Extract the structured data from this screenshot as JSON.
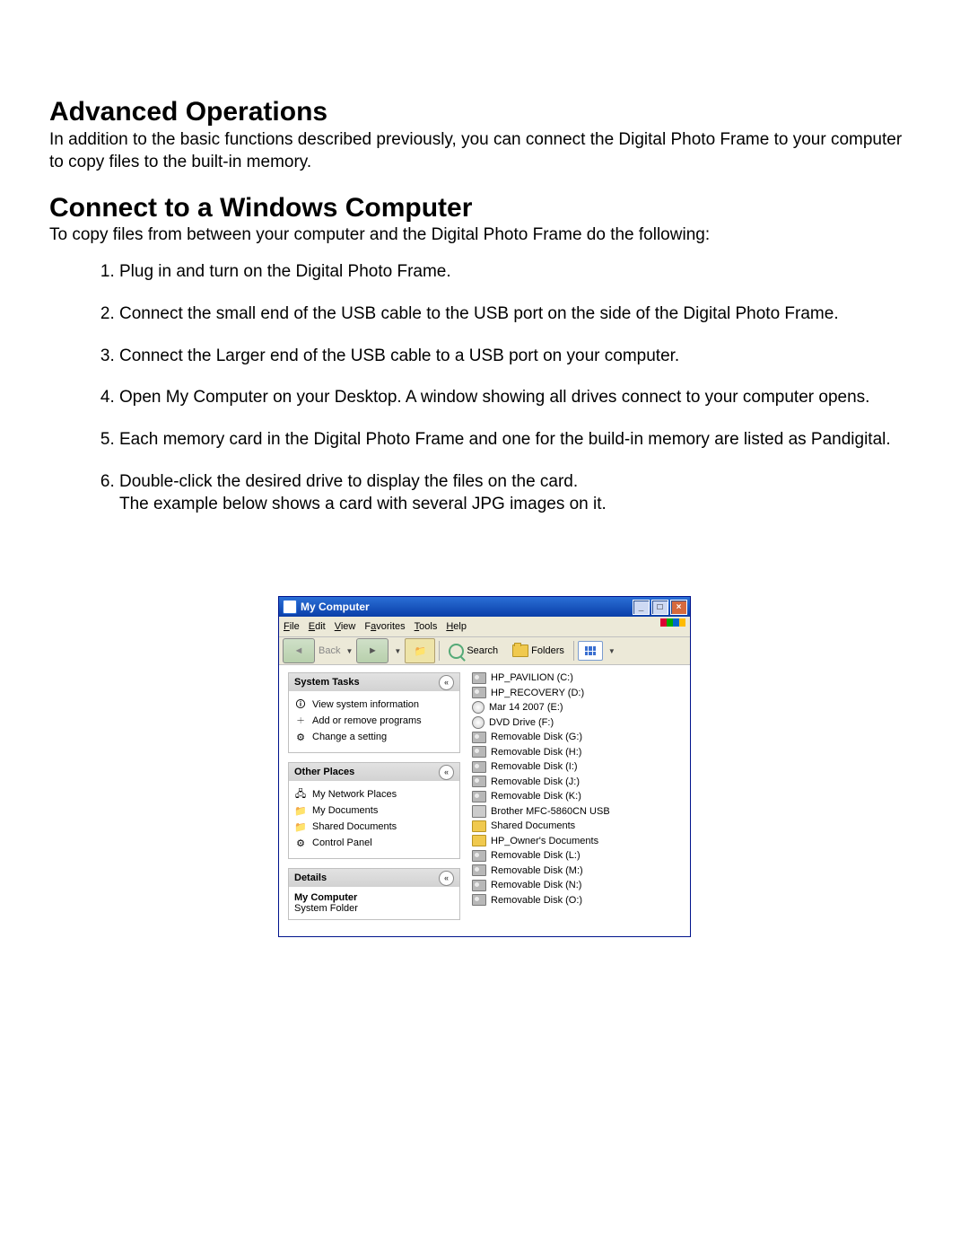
{
  "headings": {
    "h1": "Advanced Operations",
    "h2": "Connect to a Windows Computer"
  },
  "paragraphs": {
    "intro1": "In addition to the basic functions described previously, you can connect the Digital Photo Frame to your computer to copy files to the built-in memory.",
    "intro2": "To copy files from between your computer and the Digital Photo Frame do the following:"
  },
  "steps": [
    "Plug in and turn on the Digital Photo Frame.",
    "Connect the small end of the USB cable to the USB port on the side of the Digital Photo Frame.",
    "Connect the Larger end of the USB cable to a USB port on your computer.",
    "Open My Computer on your Desktop. A window showing all drives connect to your computer opens.",
    "Each memory card in the Digital Photo Frame and one for the build-in memory are listed as Pandigital.",
    "Double-click the desired drive to display the files on the card.\nThe example below shows a card with several JPG images on it."
  ],
  "window": {
    "title": "My Computer",
    "menu": {
      "file": "File",
      "edit": "Edit",
      "view": "View",
      "favorites": "Favorites",
      "tools": "Tools",
      "help": "Help"
    },
    "toolbar": {
      "back": "Back",
      "search": "Search",
      "folders": "Folders"
    },
    "panels": {
      "system": {
        "title": "System Tasks",
        "items": [
          "View system information",
          "Add or remove programs",
          "Change a setting"
        ]
      },
      "other": {
        "title": "Other Places",
        "items": [
          "My Network Places",
          "My Documents",
          "Shared Documents",
          "Control Panel"
        ]
      },
      "details": {
        "title": "Details",
        "name": "My Computer",
        "type": "System Folder"
      }
    },
    "drives": [
      {
        "label": "HP_PAVILION (C:)",
        "icon": "disk"
      },
      {
        "label": "HP_RECOVERY (D:)",
        "icon": "disk"
      },
      {
        "label": "Mar 14 2007 (E:)",
        "icon": "cd"
      },
      {
        "label": "DVD Drive (F:)",
        "icon": "cd"
      },
      {
        "label": "Removable Disk (G:)",
        "icon": "disk"
      },
      {
        "label": "Removable Disk (H:)",
        "icon": "disk"
      },
      {
        "label": "Removable Disk (I:)",
        "icon": "disk"
      },
      {
        "label": "Removable Disk (J:)",
        "icon": "disk"
      },
      {
        "label": "Removable Disk (K:)",
        "icon": "disk"
      },
      {
        "label": "Brother MFC-5860CN USB",
        "icon": "printer"
      },
      {
        "label": "Shared Documents",
        "icon": "folder"
      },
      {
        "label": "HP_Owner's Documents",
        "icon": "folder"
      },
      {
        "label": "Removable Disk (L:)",
        "icon": "disk"
      },
      {
        "label": "Removable Disk (M:)",
        "icon": "disk"
      },
      {
        "label": "Removable Disk (N:)",
        "icon": "disk"
      },
      {
        "label": "Removable Disk (O:)",
        "icon": "disk"
      }
    ]
  }
}
